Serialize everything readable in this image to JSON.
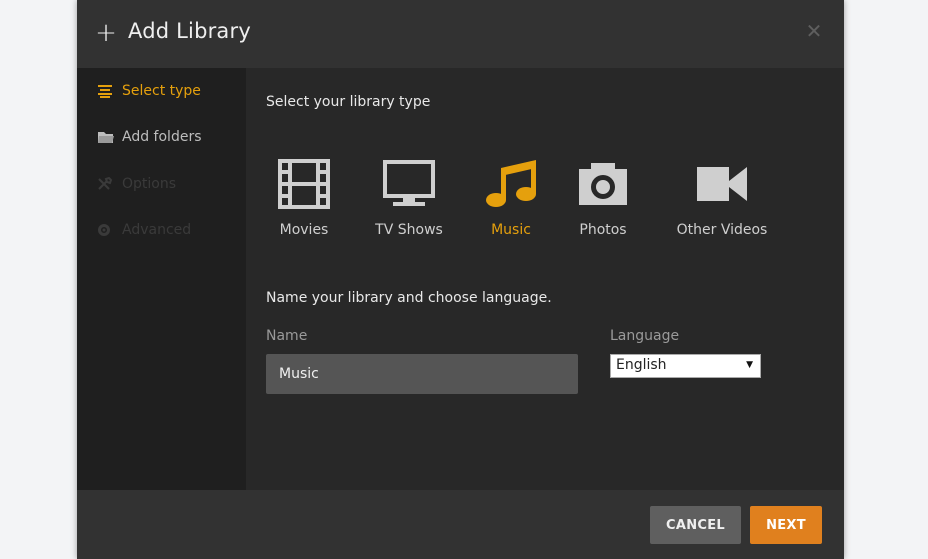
{
  "header": {
    "title": "Add Library"
  },
  "sidebar": {
    "items": [
      {
        "label": "Select type",
        "state": "active",
        "icon": "list-icon"
      },
      {
        "label": "Add folders",
        "state": "normal",
        "icon": "folder-icon"
      },
      {
        "label": "Options",
        "state": "disabled",
        "icon": "wrench-icon"
      },
      {
        "label": "Advanced",
        "state": "disabled",
        "icon": "gear-icon"
      }
    ]
  },
  "main": {
    "type_heading": "Select your library type",
    "types": [
      {
        "label": "Movies",
        "icon": "film-icon",
        "selected": false
      },
      {
        "label": "TV Shows",
        "icon": "tv-icon",
        "selected": false
      },
      {
        "label": "Music",
        "icon": "music-note-icon",
        "selected": true
      },
      {
        "label": "Photos",
        "icon": "camera-icon",
        "selected": false
      },
      {
        "label": "Other Videos",
        "icon": "video-camera-icon",
        "selected": false
      }
    ],
    "name_heading": "Name your library and choose language.",
    "name_label": "Name",
    "name_value": "Music",
    "language_label": "Language",
    "language_value": "English"
  },
  "footer": {
    "cancel_label": "CANCEL",
    "next_label": "NEXT"
  },
  "colors": {
    "accent": "#e5a00d",
    "next_button": "#e0801e",
    "cancel_button": "#5f5f5f",
    "modal_bg": "#282828",
    "sidebar_bg": "#1f1f1f"
  }
}
